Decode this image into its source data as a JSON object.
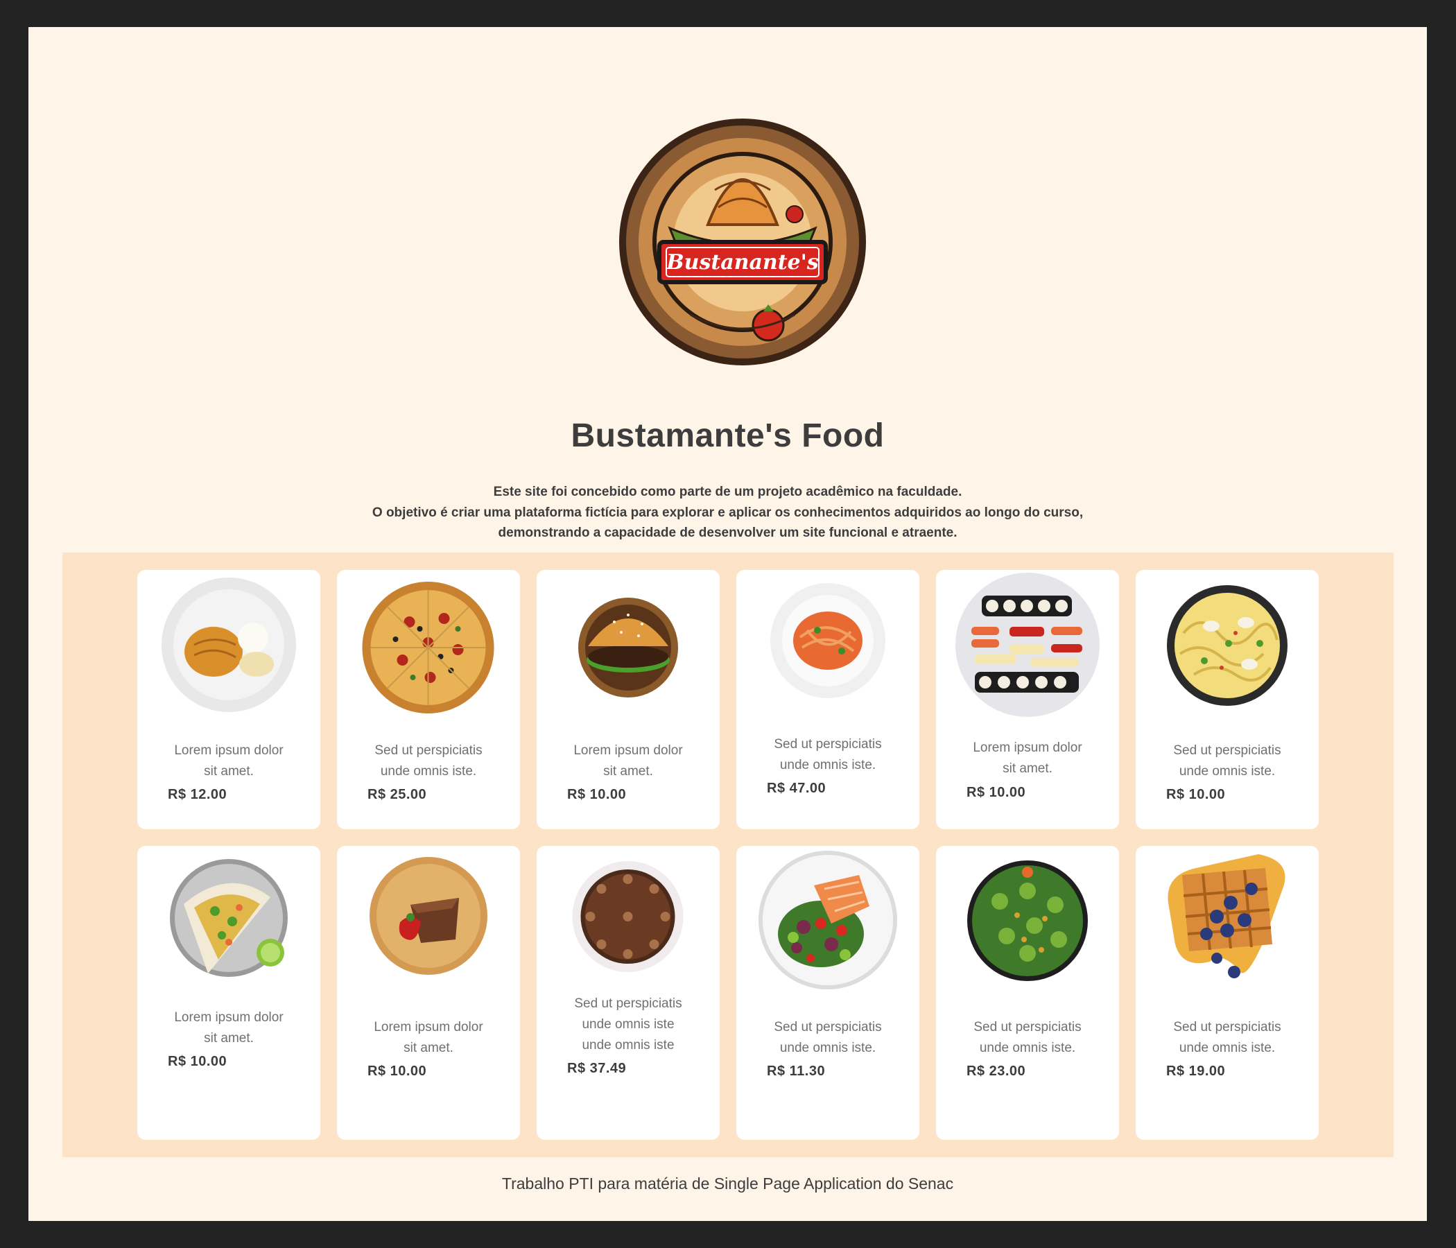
{
  "brand": {
    "logo_text": "Bustanante's",
    "title": "Bustamante's Food"
  },
  "intro": {
    "line1": "Este site foi concebido como parte de um projeto acadêmico na faculdade.",
    "line2": "O objetivo é criar uma plataforma fictícia para explorar e aplicar os conhecimentos adquiridos ao longo do curso,",
    "line3": "demonstrando a capacidade de desenvolver um site funcional e atraente."
  },
  "menu": {
    "items": [
      {
        "dish": "chicken-rice-plate-icon",
        "desc": [
          "Lorem ipsum dolor",
          "sit amet."
        ],
        "price": "R$ 12.00"
      },
      {
        "dish": "pizza-icon",
        "desc": [
          "Sed ut perspiciatis",
          "unde omnis iste."
        ],
        "price": "R$ 25.00"
      },
      {
        "dish": "burger-icon",
        "desc": [
          "Lorem ipsum dolor",
          "sit amet."
        ],
        "price": "R$ 10.00"
      },
      {
        "dish": "spaghetti-icon",
        "desc": [
          "Sed ut perspiciatis",
          "unde omnis iste."
        ],
        "price": "R$ 47.00"
      },
      {
        "dish": "sushi-platter-icon",
        "desc": [
          "Lorem ipsum dolor",
          "sit amet."
        ],
        "price": "R$ 10.00"
      },
      {
        "dish": "noodle-bowl-icon",
        "desc": [
          "Sed ut perspiciatis",
          "unde omnis iste."
        ],
        "price": "R$ 10.00"
      },
      {
        "dish": "tacos-icon",
        "desc": [
          "Lorem ipsum dolor",
          "sit amet."
        ],
        "price": "R$ 10.00"
      },
      {
        "dish": "cake-slice-icon",
        "desc": [
          "Lorem ipsum dolor",
          "sit amet."
        ],
        "price": "R$ 10.00"
      },
      {
        "dish": "chocolate-cake-icon",
        "desc": [
          "Sed ut perspiciatis",
          "unde omnis iste",
          "unde omnis iste"
        ],
        "price": "R$ 37.49"
      },
      {
        "dish": "salmon-salad-icon",
        "desc": [
          "Sed ut perspiciatis",
          "unde omnis iste."
        ],
        "price": "R$ 11.30"
      },
      {
        "dish": "green-salad-icon",
        "desc": [
          "Sed ut perspiciatis",
          "unde omnis iste."
        ],
        "price": "R$ 23.00"
      },
      {
        "dish": "waffle-icon",
        "desc": [
          "Sed ut perspiciatis",
          "unde omnis iste."
        ],
        "price": "R$ 19.00"
      }
    ]
  },
  "footer": {
    "text": "Trabalho PTI para matéria de Single Page Application do Senac"
  },
  "colors": {
    "page_bg": "#fef4e8",
    "menu_bg": "#fbe3c7",
    "frame": "#232323",
    "heading": "#3d3d3d",
    "body_text": "#707070"
  }
}
